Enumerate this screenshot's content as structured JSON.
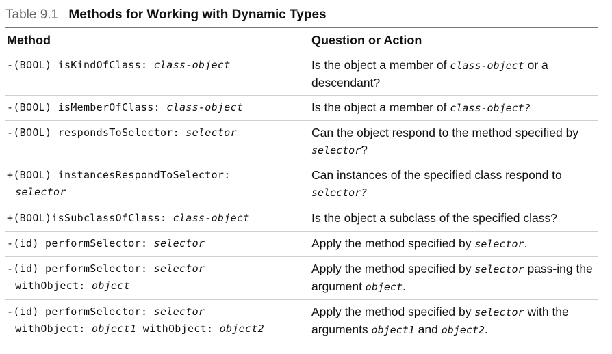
{
  "caption": {
    "number": "Table 9.1",
    "title": "Methods for Working with Dynamic Types"
  },
  "headers": {
    "method": "Method",
    "action": "Question or Action"
  },
  "rows": [
    {
      "m1_pre": "-(BOOL) isKindOfClass: ",
      "m1_arg": "class-object",
      "d_a": "Is the object a member of ",
      "d_code": "class-object",
      "d_b": " or a descendant?"
    },
    {
      "m1_pre": "-(BOOL) isMemberOfClass: ",
      "m1_arg": "class-object",
      "d_a": "Is the object a member of ",
      "d_code": "class-object?"
    },
    {
      "m1_pre": "-(BOOL) respondsToSelector: ",
      "m1_arg": "selector",
      "d_a": "Can the object respond to the method specified by ",
      "d_code": "selector",
      "d_b": "?"
    },
    {
      "m1_pre": "+(BOOL) instancesRespondToSelector:",
      "m2_arg": "selector",
      "d_a": "Can instances of the specified class respond to ",
      "d_code": "selector?"
    },
    {
      "m1_pre": "+(BOOL)isSubclassOfClass: ",
      "m1_arg": "class-object",
      "d_a": "Is the object a subclass of the specified class?"
    },
    {
      "m1_pre": "-(id) performSelector: ",
      "m1_arg": "selector",
      "d_a": "Apply the method specified by ",
      "d_code": "selector",
      "d_b": "."
    },
    {
      "m1_pre": "-(id) performSelector: ",
      "m1_arg": "selector",
      "m2_pre": "withObject: ",
      "m2_arg": "object",
      "d_a": "Apply the method specified by ",
      "d_code": "selector",
      "d_b": " pass-ing the argument ",
      "d_code2": "object",
      "d_c": "."
    },
    {
      "m1_pre": "-(id) performSelector: ",
      "m1_arg": "selector",
      "m2_pre": "withObject: ",
      "m2_arg": "object1",
      "m2_mid": " withObject: ",
      "m2_arg2": "object2",
      "d_a": "Apply the method specified by ",
      "d_code": "selector",
      "d_b": " with the arguments ",
      "d_code2": "object1",
      "d_c": " and ",
      "d_code3": "object2",
      "d_d": "."
    }
  ]
}
